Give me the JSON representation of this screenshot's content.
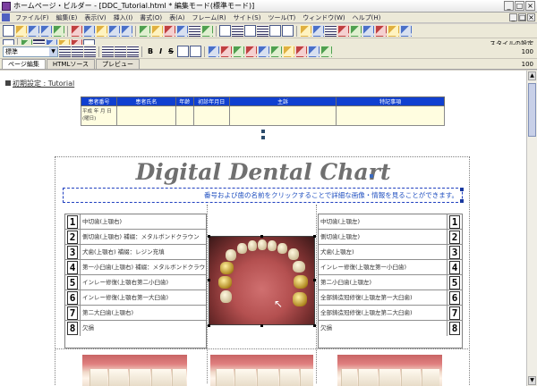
{
  "window": {
    "title": "ホームページ・ビルダー - [DDC_Tutorial.html  * 編集モード(標準モード)]",
    "controls": [
      "_",
      "□",
      "×"
    ]
  },
  "menu": {
    "items": [
      "ファイル(F)",
      "編集(E)",
      "表示(V)",
      "挿入(I)",
      "書式(O)",
      "表(A)",
      "フレーム(R)",
      "サイト(S)",
      "ツール(T)",
      "ウィンドウ(W)",
      "ヘルプ(H)"
    ],
    "right_controls": [
      "_",
      "□",
      "×"
    ]
  },
  "toolbar2": {
    "right_label": "スタイルの設定"
  },
  "toolbar3": {
    "style_value": "標準",
    "bold": "B",
    "italic": "I",
    "strike": "S",
    "right_label": "100"
  },
  "tabs": {
    "items": [
      "ページ編集",
      "HTMLソース",
      "プレビュー"
    ],
    "right_label": "100"
  },
  "page": {
    "breadcrumb": "初期設定 : Tutorial",
    "info_table": {
      "headers": [
        "患者番号",
        "患者氏名",
        "年齢",
        "初診年月日",
        "主訴",
        "特記事項"
      ],
      "cells": [
        "平成 年 月 日(曜日)",
        "",
        "",
        "",
        "",
        ""
      ]
    },
    "chart_title": "Digital Dental Chart",
    "subtitle": "番号および歯の名前をクリックすることで詳細な画像・情報を見ることができます。",
    "left_teeth": [
      {
        "num": "1",
        "label": "中切歯(上顎右)"
      },
      {
        "num": "2",
        "label": "側切歯(上顎右) 補綴：メタルボンドクラウン"
      },
      {
        "num": "3",
        "label": "犬歯(上顎右) 補綴：レジン充填"
      },
      {
        "num": "4",
        "label": "第一小臼歯(上顎右) 補綴：メタルボンドクラウン"
      },
      {
        "num": "5",
        "label": "インレー修復(上顎右第二小臼歯)"
      },
      {
        "num": "6",
        "label": "インレー修復(上顎右第一大臼歯)"
      },
      {
        "num": "7",
        "label": "第二大臼歯(上顎右)"
      },
      {
        "num": "8",
        "label": "欠損"
      }
    ],
    "right_teeth": [
      {
        "num": "1",
        "label": "中切歯(上顎左)"
      },
      {
        "num": "2",
        "label": "側切歯(上顎左)"
      },
      {
        "num": "3",
        "label": "犬歯(上顎左)"
      },
      {
        "num": "4",
        "label": "インレー修復(上顎左第一小臼歯)"
      },
      {
        "num": "5",
        "label": "第二小臼歯(上顎左)"
      },
      {
        "num": "6",
        "label": "全部鋳造冠修復(上顎左第一大臼歯)"
      },
      {
        "num": "7",
        "label": "全部鋳造冠修復(上顎左第二大臼歯)"
      },
      {
        "num": "8",
        "label": "欠損"
      }
    ]
  }
}
